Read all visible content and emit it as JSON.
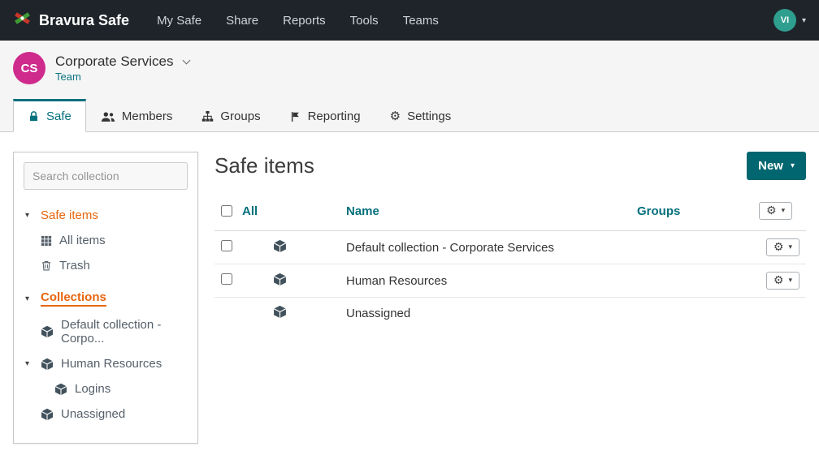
{
  "colors": {
    "navbar_bg": "#1f242a",
    "accent_teal": "#04707c",
    "button_teal": "#026670",
    "orange": "#e8650d",
    "avatar_teal": "#2e9e8f",
    "avatar_pink": "#cf2b8d",
    "band_gray": "#f5f5f5"
  },
  "icons": {
    "gear": "⚙",
    "caret_down": "▾"
  },
  "navbar": {
    "brand": "Bravura Safe",
    "items": [
      "My Safe",
      "Share",
      "Reports",
      "Tools",
      "Teams"
    ],
    "avatar_initials": "VI"
  },
  "team_header": {
    "avatar_initials": "CS",
    "title": "Corporate Services",
    "subtitle": "Team"
  },
  "tabs": [
    {
      "label": "Safe",
      "active": true
    },
    {
      "label": "Members",
      "active": false
    },
    {
      "label": "Groups",
      "active": false
    },
    {
      "label": "Reporting",
      "active": false
    },
    {
      "label": "Settings",
      "active": false
    }
  ],
  "sidebar": {
    "search_placeholder": "Search collection",
    "items": [
      {
        "label": "Safe items"
      },
      {
        "label": "All items"
      },
      {
        "label": "Trash"
      },
      {
        "label": "Collections"
      },
      {
        "label": "Default collection - Corpo..."
      },
      {
        "label": "Human Resources"
      },
      {
        "label": "Logins"
      },
      {
        "label": "Unassigned"
      }
    ]
  },
  "main": {
    "title": "Safe items",
    "new_button_label": "New",
    "table": {
      "headers": {
        "select": "All",
        "name": "Name",
        "groups": "Groups"
      },
      "rows": [
        {
          "name": "Default collection - Corporate Services",
          "selectable": true,
          "has_actions": true
        },
        {
          "name": "Human Resources",
          "selectable": true,
          "has_actions": true
        },
        {
          "name": "Unassigned",
          "selectable": false,
          "has_actions": false
        }
      ]
    }
  }
}
